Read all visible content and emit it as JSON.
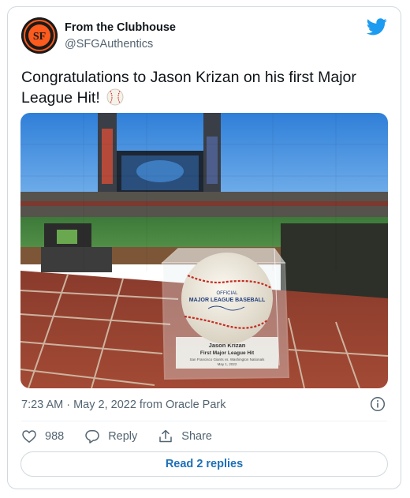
{
  "tweet": {
    "author_name": "From the Clubhouse",
    "author_handle": "@SFGAuthentics",
    "text": "Congratulations to Jason Krizan on his first Major League Hit!",
    "emoji_icon": "baseball-emoji",
    "timestamp": "7:23 AM · May 2, 2022 from Oracle Park",
    "likes_count": "988",
    "reply_label": "Reply",
    "share_label": "Share",
    "read_replies_label": "Read 2 replies"
  },
  "photo": {
    "ball_stamp_line1": "OFFICIAL",
    "ball_stamp_line2": "MAJOR LEAGUE BASEBALL",
    "plaque_name": "Jason Krizan",
    "plaque_event": "First Major League Hit",
    "plaque_game": "San Francisco Giants vs. Washington Nationals",
    "plaque_date": "May 1, 2022"
  },
  "colors": {
    "twitter_blue": "#1d9bf0",
    "muted_text": "#536471",
    "link_blue": "#1d6fb8",
    "border": "#cfd9de"
  }
}
